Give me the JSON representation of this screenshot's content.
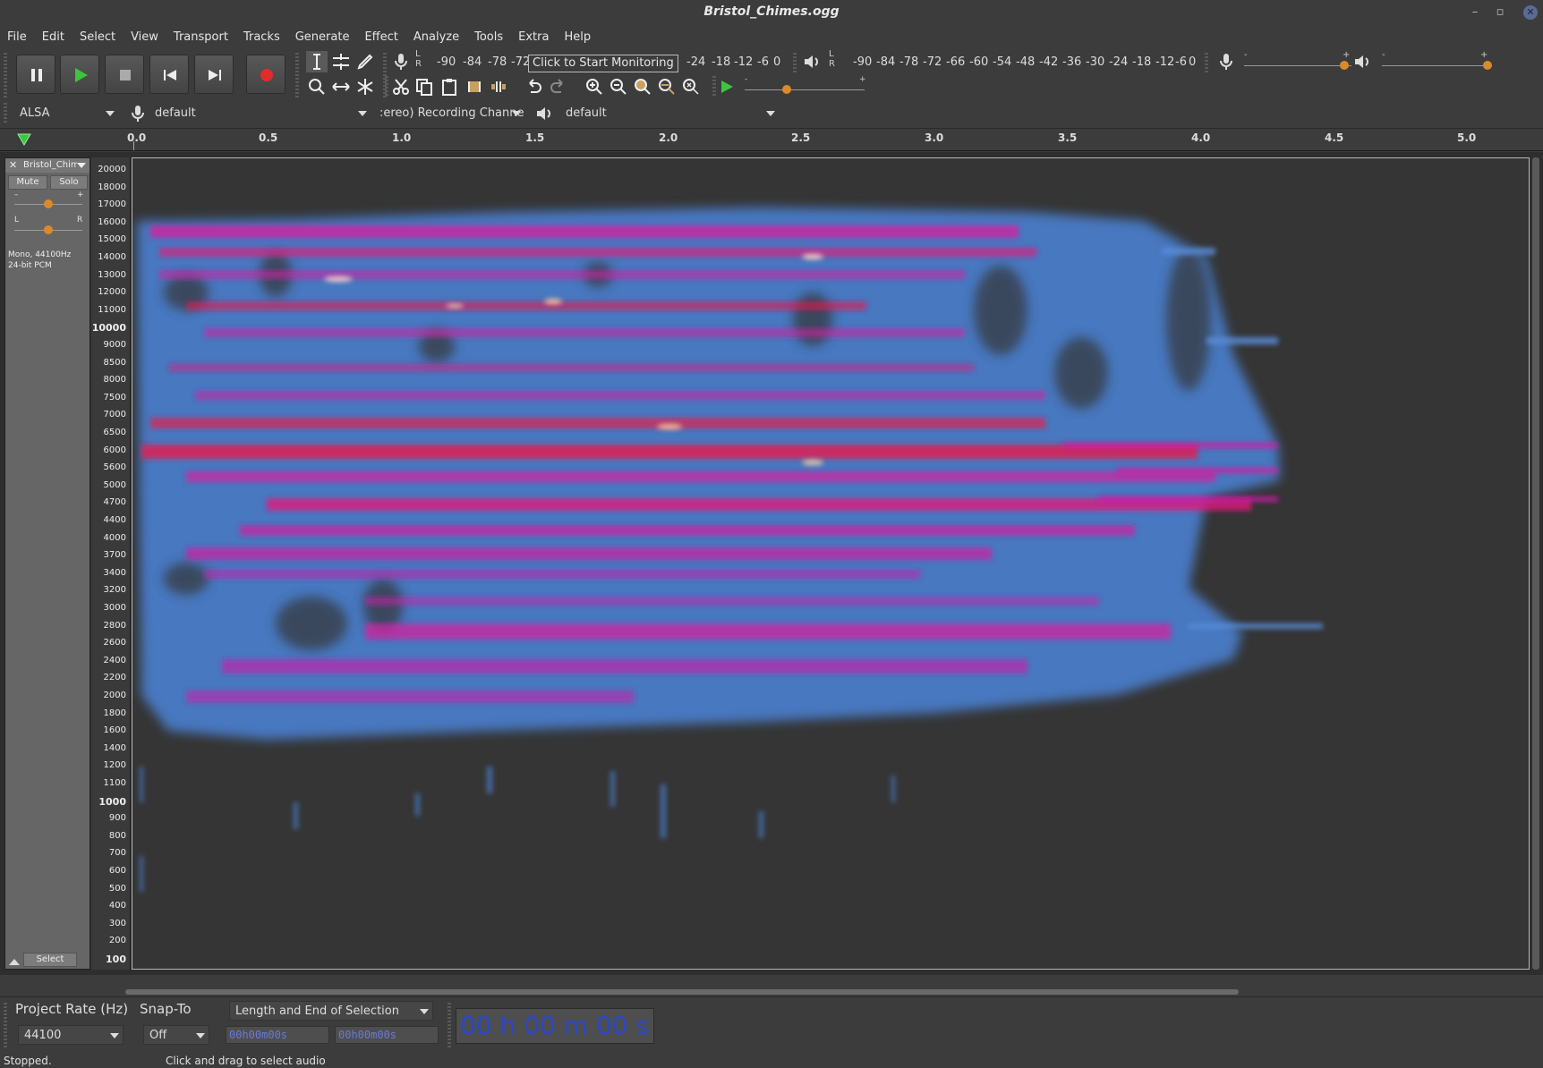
{
  "window": {
    "title": "Bristol_Chimes.ogg",
    "minimize": "–",
    "maximize": "▫",
    "close": "✕"
  },
  "menu": [
    "File",
    "Edit",
    "Select",
    "View",
    "Transport",
    "Tracks",
    "Generate",
    "Effect",
    "Analyze",
    "Tools",
    "Extra",
    "Help"
  ],
  "meters": {
    "record_scale": [
      "-90",
      "-84",
      "-78",
      "-72"
    ],
    "record_scale_tail": [
      "-24",
      "-18",
      "-12",
      "-6",
      "0"
    ],
    "monitor_label": "Click to Start Monitoring",
    "playback_scale": [
      "-90",
      "-84",
      "-78",
      "-72",
      "-66",
      "-60",
      "-54",
      "-48",
      "-42",
      "-36",
      "-30",
      "-24",
      "-18",
      "-12",
      "-6",
      "0"
    ],
    "lr_l": "L",
    "lr_r": "R",
    "rec_vol_minus": "-",
    "rec_vol_plus": "+",
    "play_vol_minus": "-",
    "play_vol_plus": "+",
    "speed_minus": "-",
    "speed_plus": "+",
    "rec_volume_level": 0.93,
    "play_volume_level": 0.98,
    "play_speed_level": 0.35
  },
  "device": {
    "host": "ALSA",
    "input": "default",
    "channels": ":ereo) Recording Channels",
    "output": "default"
  },
  "ruler": {
    "ticks": [
      "0.0",
      "0.5",
      "1.0",
      "1.5",
      "2.0",
      "2.5",
      "3.0",
      "3.5",
      "4.0",
      "4.5",
      "5.0"
    ]
  },
  "track": {
    "name": "Bristol_Chim",
    "mute": "Mute",
    "solo": "Solo",
    "gain_minus": "–",
    "gain_plus": "+",
    "pan_l": "L",
    "pan_r": "R",
    "info_line1": "Mono, 44100Hz",
    "info_line2": "24-bit PCM",
    "select": "Select",
    "gain_level": 0.5,
    "pan_level": 0.5,
    "close": "✕"
  },
  "freq_axis": [
    {
      "v": "20000",
      "b": false
    },
    {
      "v": "18000",
      "b": false
    },
    {
      "v": "17000",
      "b": false
    },
    {
      "v": "16000",
      "b": false
    },
    {
      "v": "15000",
      "b": false
    },
    {
      "v": "14000",
      "b": false
    },
    {
      "v": "13000",
      "b": false
    },
    {
      "v": "12000",
      "b": false
    },
    {
      "v": "11000",
      "b": false
    },
    {
      "v": "10000",
      "b": true
    },
    {
      "v": "9000",
      "b": false
    },
    {
      "v": "8500",
      "b": false
    },
    {
      "v": "8000",
      "b": false
    },
    {
      "v": "7500",
      "b": false
    },
    {
      "v": "7000",
      "b": false
    },
    {
      "v": "6500",
      "b": false
    },
    {
      "v": "6000",
      "b": false
    },
    {
      "v": "5600",
      "b": false
    },
    {
      "v": "5000",
      "b": false
    },
    {
      "v": "4700",
      "b": false
    },
    {
      "v": "4400",
      "b": false
    },
    {
      "v": "4000",
      "b": false
    },
    {
      "v": "3700",
      "b": false
    },
    {
      "v": "3400",
      "b": false
    },
    {
      "v": "3200",
      "b": false
    },
    {
      "v": "3000",
      "b": false
    },
    {
      "v": "2800",
      "b": false
    },
    {
      "v": "2600",
      "b": false
    },
    {
      "v": "2400",
      "b": false
    },
    {
      "v": "2200",
      "b": false
    },
    {
      "v": "2000",
      "b": false
    },
    {
      "v": "1800",
      "b": false
    },
    {
      "v": "1600",
      "b": false
    },
    {
      "v": "1400",
      "b": false
    },
    {
      "v": "1200",
      "b": false
    },
    {
      "v": "1100",
      "b": false
    },
    {
      "v": "1000",
      "b": true
    },
    {
      "v": "900",
      "b": false
    },
    {
      "v": "800",
      "b": false
    },
    {
      "v": "700",
      "b": false
    },
    {
      "v": "600",
      "b": false
    },
    {
      "v": "500",
      "b": false
    },
    {
      "v": "400",
      "b": false
    },
    {
      "v": "300",
      "b": false
    },
    {
      "v": "200",
      "b": false
    },
    {
      "v": "100",
      "b": true
    }
  ],
  "bottom": {
    "project_rate_label": "Project Rate (Hz)",
    "project_rate": "44100",
    "snap_label": "Snap-To",
    "snap": "Off",
    "selection_mode": "Length and End of Selection",
    "sel_start": "00h00m00s",
    "sel_end": "00h00m00s",
    "time_hh": "00",
    "time_h": "h",
    "time_mm": "00",
    "time_m": "m",
    "time_ss": "00",
    "time_s": "s"
  },
  "status": {
    "state": "Stopped.",
    "hint": "Click and drag to select audio"
  },
  "colors": {
    "accent_orange": "#d98a2b",
    "spectro_high": "#e8184a",
    "spectro_mid": "#d21fa0",
    "spectro_low": "#4a82d0",
    "time_blue": "#2b47c6"
  }
}
